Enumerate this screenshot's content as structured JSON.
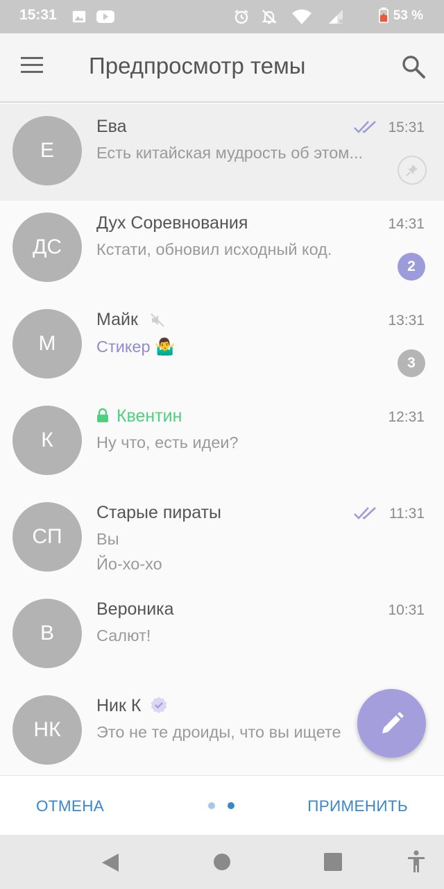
{
  "status_bar": {
    "time": "15:31",
    "battery_percent": "53 %",
    "icons": [
      "image-icon",
      "youtube-icon",
      "alarm-icon",
      "notifications-off-icon",
      "wifi-icon",
      "signal-icon",
      "battery-saver-icon"
    ]
  },
  "toolbar": {
    "title": "Предпросмотр темы",
    "menu_icon": "menu-icon",
    "search_icon": "search-icon"
  },
  "chats": [
    {
      "avatar": "Е",
      "name": "Ева",
      "time": "15:31",
      "message": "Есть китайская мудрость об этом...",
      "read": true,
      "pinned": true
    },
    {
      "avatar": "ДС",
      "name": "Дух Соревнования",
      "time": "14:31",
      "message": "Кстати, обновил исходный код.",
      "unread": "2"
    },
    {
      "avatar": "М",
      "name": "Майк",
      "time": "13:31",
      "message": "Стикер",
      "sticker_emoji": "🤷‍♂️",
      "muted": true,
      "unread": "3"
    },
    {
      "avatar": "К",
      "name": "Квентин",
      "time": "12:31",
      "message": "Ну что, есть идеи?",
      "secret": true
    },
    {
      "avatar": "СП",
      "name": "Старые пираты",
      "time": "11:31",
      "sender": "Вы",
      "message": "Йо-хо-хо",
      "read": true
    },
    {
      "avatar": "В",
      "name": "Вероника",
      "time": "10:31",
      "message": "Салют!"
    },
    {
      "avatar": "НК",
      "name": "Ник К",
      "time": "",
      "message": "Это не те дроиды, что вы ищете",
      "verified": true
    }
  ],
  "actions": {
    "cancel": "ОТМЕНА",
    "apply": "ПРИМЕНИТЬ"
  },
  "colors": {
    "accent": "#3b86c6",
    "avatar": "#b3b3b3",
    "fab": "#a49fdc",
    "secret_chat": "#4ed17e",
    "unread_badge": "#9e9bdb"
  }
}
